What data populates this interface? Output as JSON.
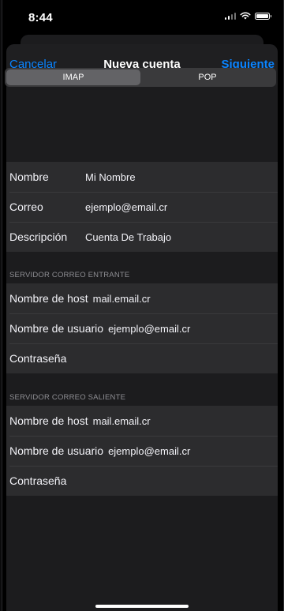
{
  "status": {
    "time": "8:44"
  },
  "nav": {
    "cancel": "Cancelar",
    "title": "Nueva cuenta",
    "next": "Siguiente"
  },
  "account_type": {
    "options": [
      "IMAP",
      "POP"
    ],
    "selected": "IMAP"
  },
  "account": {
    "name_label": "Nombre",
    "name_value": "Mi Nombre",
    "email_label": "Correo",
    "email_value": "ejemplo@email.cr",
    "description_label": "Descripción",
    "description_value": "Cuenta De Trabajo"
  },
  "incoming": {
    "header": "SERVIDOR CORREO ENTRANTE",
    "host_label": "Nombre de host",
    "host_value": "mail.email.cr",
    "user_label": "Nombre de usuario",
    "user_value": "ejemplo@email.cr",
    "password_label": "Contraseña"
  },
  "outgoing": {
    "header": "SERVIDOR CORREO SALIENTE",
    "host_label": "Nombre de host",
    "host_value": "mail.email.cr",
    "user_label": "Nombre de usuario",
    "user_value": "ejemplo@email.cr",
    "password_label": "Contraseña"
  },
  "colors": {
    "accent": "#0a84ff",
    "background": "#1c1c1e",
    "cell": "#2c2c2e"
  }
}
